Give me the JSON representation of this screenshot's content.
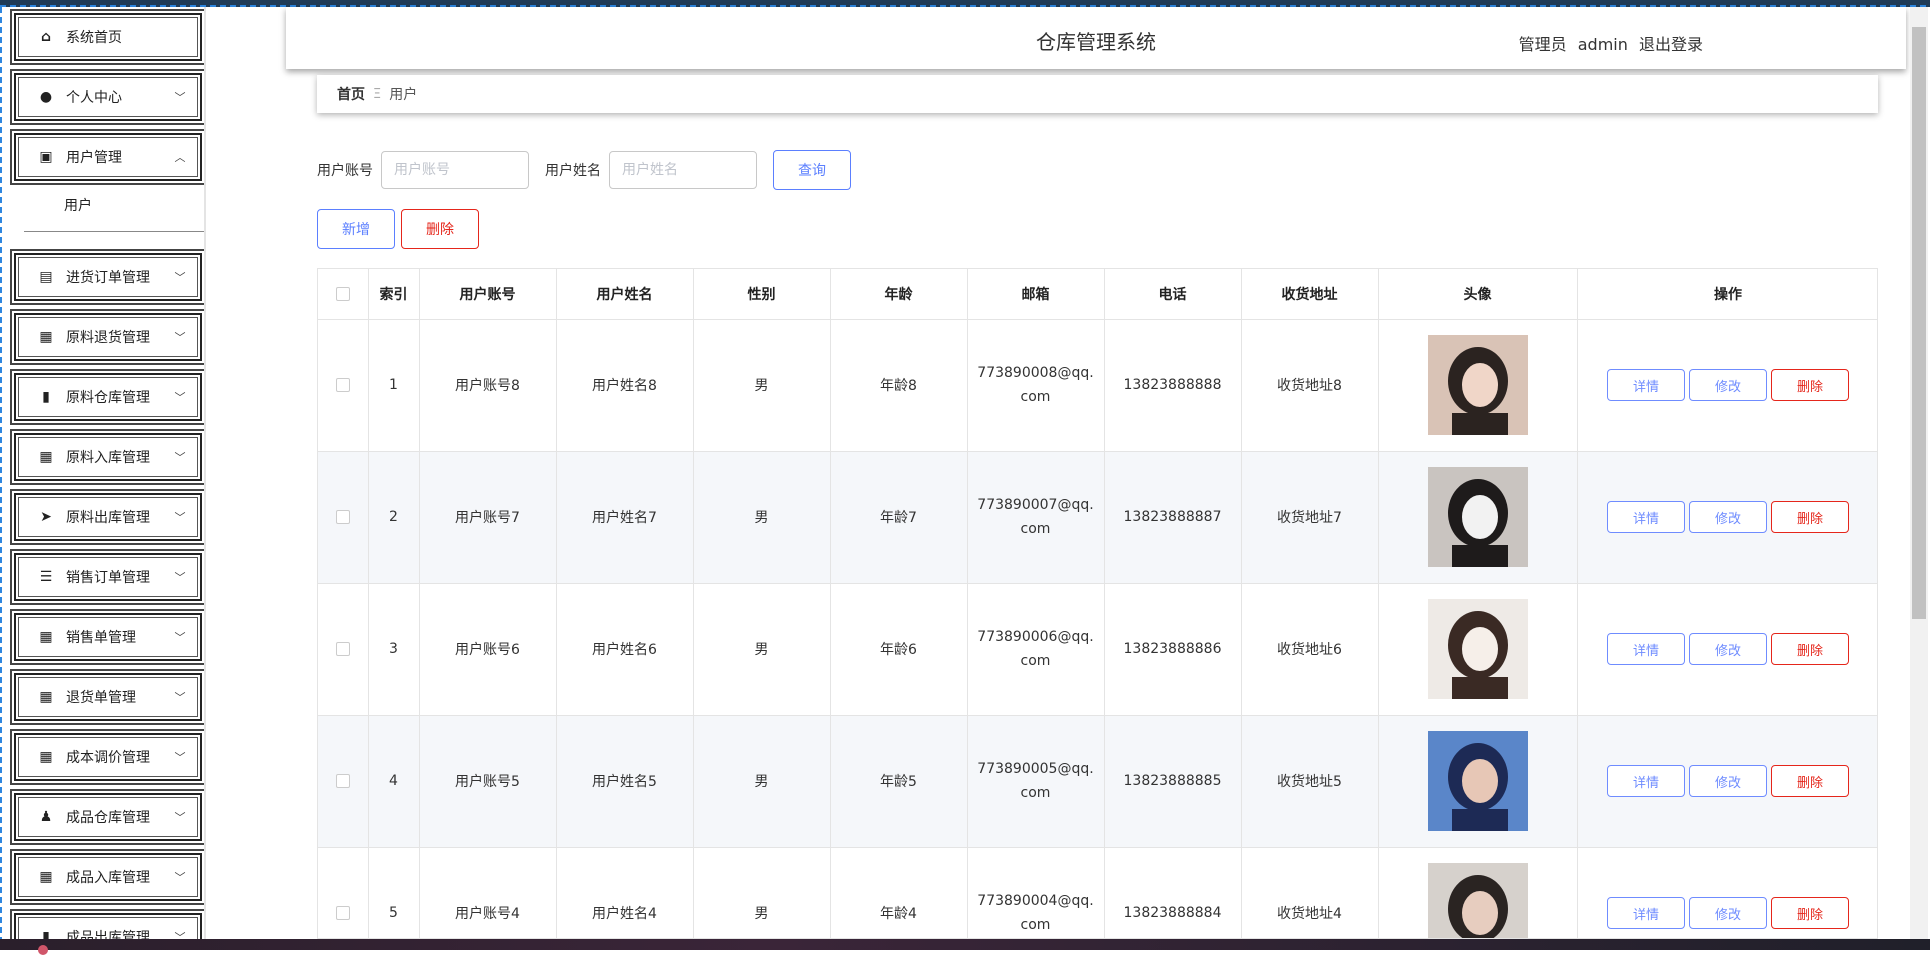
{
  "header": {
    "title": "仓库管理系统",
    "role": "管理员",
    "username": "admin",
    "logout": "退出登录"
  },
  "sidebar": {
    "items": [
      {
        "label": "系统首页",
        "icon": "home-icon",
        "glyph": "⌂",
        "expandable": false
      },
      {
        "label": "个人中心",
        "icon": "person-icon",
        "glyph": "●",
        "expandable": true
      },
      {
        "label": "用户管理",
        "icon": "trend-chart-icon",
        "glyph": "▣",
        "expandable": true,
        "expanded": true
      },
      {
        "label": "进货订单管理",
        "icon": "clipboard-icon",
        "glyph": "▤",
        "expandable": true
      },
      {
        "label": "原料退货管理",
        "icon": "grid-icon",
        "glyph": "▦",
        "expandable": true
      },
      {
        "label": "原料仓库管理",
        "icon": "bar-chart-icon",
        "glyph": "▮",
        "expandable": true
      },
      {
        "label": "原料入库管理",
        "icon": "grid-icon",
        "glyph": "▦",
        "expandable": true
      },
      {
        "label": "原料出库管理",
        "icon": "paper-plane-icon",
        "glyph": "➤",
        "expandable": true
      },
      {
        "label": "销售订单管理",
        "icon": "list-icon",
        "glyph": "☰",
        "expandable": true
      },
      {
        "label": "销售单管理",
        "icon": "grid-icon",
        "glyph": "▦",
        "expandable": true
      },
      {
        "label": "退货单管理",
        "icon": "grid-icon",
        "glyph": "▦",
        "expandable": true
      },
      {
        "label": "成本调价管理",
        "icon": "grid-icon",
        "glyph": "▦",
        "expandable": true
      },
      {
        "label": "成品仓库管理",
        "icon": "stamp-icon",
        "glyph": "♟",
        "expandable": true
      },
      {
        "label": "成品入库管理",
        "icon": "grid-icon",
        "glyph": "▦",
        "expandable": true
      },
      {
        "label": "成品出库管理",
        "icon": "bar-chart-icon",
        "glyph": "▮",
        "expandable": true
      }
    ],
    "submenu": {
      "label": "用户"
    }
  },
  "breadcrumb": {
    "home": "首页",
    "separator": "Ξ",
    "current": "用户"
  },
  "search": {
    "account_label": "用户账号",
    "account_placeholder": "用户账号",
    "name_label": "用户姓名",
    "name_placeholder": "用户姓名",
    "query": "查询"
  },
  "actions": {
    "add": "新增",
    "delete": "删除"
  },
  "table": {
    "headers": [
      "索引",
      "用户账号",
      "用户姓名",
      "性别",
      "年龄",
      "邮箱",
      "电话",
      "收货地址",
      "头像",
      "操作"
    ],
    "buttons": {
      "detail": "详情",
      "edit": "修改",
      "delete": "删除"
    },
    "rows": [
      {
        "index": "1",
        "account": "用户账号8",
        "name": "用户姓名8",
        "gender": "男",
        "age": "年龄8",
        "email": "773890008@qq.com",
        "phone": "13823888888",
        "address": "收货地址8",
        "avatar_colors": [
          "#d9c3b6",
          "#2b2320",
          "#f0d6c8"
        ]
      },
      {
        "index": "2",
        "account": "用户账号7",
        "name": "用户姓名7",
        "gender": "男",
        "age": "年龄7",
        "email": "773890007@qq.com",
        "phone": "13823888887",
        "address": "收货地址7",
        "avatar_colors": [
          "#c9c4c0",
          "#1e1b1b",
          "#f2f2f2"
        ]
      },
      {
        "index": "3",
        "account": "用户账号6",
        "name": "用户姓名6",
        "gender": "男",
        "age": "年龄6",
        "email": "773890006@qq.com",
        "phone": "13823888886",
        "address": "收货地址6",
        "avatar_colors": [
          "#eeeae6",
          "#3a2a24",
          "#f6efe9"
        ]
      },
      {
        "index": "4",
        "account": "用户账号5",
        "name": "用户姓名5",
        "gender": "男",
        "age": "年龄5",
        "email": "773890005@qq.com",
        "phone": "13823888885",
        "address": "收货地址5",
        "avatar_colors": [
          "#5a86c9",
          "#1d2a55",
          "#e7c7b6"
        ]
      },
      {
        "index": "5",
        "account": "用户账号4",
        "name": "用户姓名4",
        "gender": "男",
        "age": "年龄4",
        "email": "773890004@qq.com",
        "phone": "13823888884",
        "address": "收货地址4",
        "avatar_colors": [
          "#d6d1cc",
          "#2a2422",
          "#e7cdbf"
        ]
      }
    ]
  },
  "colors": {
    "primary": "#5b7fff",
    "danger": "#e5261b",
    "row_alt": "#f5f7fa"
  }
}
